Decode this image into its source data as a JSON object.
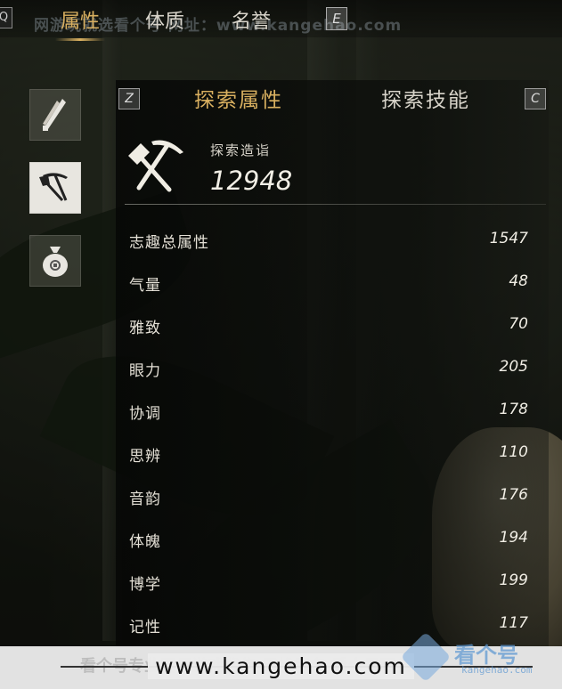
{
  "top_tabs": [
    {
      "label": "属性",
      "active": true
    },
    {
      "label": "体质",
      "active": false
    },
    {
      "label": "名誉",
      "active": false
    }
  ],
  "keys": {
    "left": "Q",
    "right": "E",
    "sub_left": "Z",
    "sub_right": "C"
  },
  "watermark_top": "网游玩就选看个号 网址：www.kangehao.com",
  "categories": [
    {
      "icon": "weapon-icon",
      "active": false
    },
    {
      "icon": "pickaxe-shovel-icon",
      "active": true
    },
    {
      "icon": "money-bag-icon",
      "active": false
    }
  ],
  "sub_tabs": [
    {
      "label": "探索属性",
      "active": true
    },
    {
      "label": "探索技能",
      "active": false
    }
  ],
  "highlight": {
    "label": "探索造诣",
    "value": "12948"
  },
  "stats": [
    {
      "name": "志趣总属性",
      "value": "1547"
    },
    {
      "name": "气量",
      "value": "48"
    },
    {
      "name": "雅致",
      "value": "70"
    },
    {
      "name": "眼力",
      "value": "205"
    },
    {
      "name": "协调",
      "value": "178"
    },
    {
      "name": "思辨",
      "value": "110"
    },
    {
      "name": "音韵",
      "value": "176"
    },
    {
      "name": "体魄",
      "value": "194"
    },
    {
      "name": "博学",
      "value": "199"
    },
    {
      "name": "记性",
      "value": "117"
    }
  ],
  "footer": {
    "url": "www.kangehao.com",
    "ghost": "看个号专业网易游戏代售 无忧服务 看个号百亿",
    "logo_text": "看个号",
    "logo_sub": "kangehao.com"
  },
  "colors": {
    "accent": "#d9b060",
    "text": "#e4e0d6",
    "panel": "#0a0c09"
  }
}
